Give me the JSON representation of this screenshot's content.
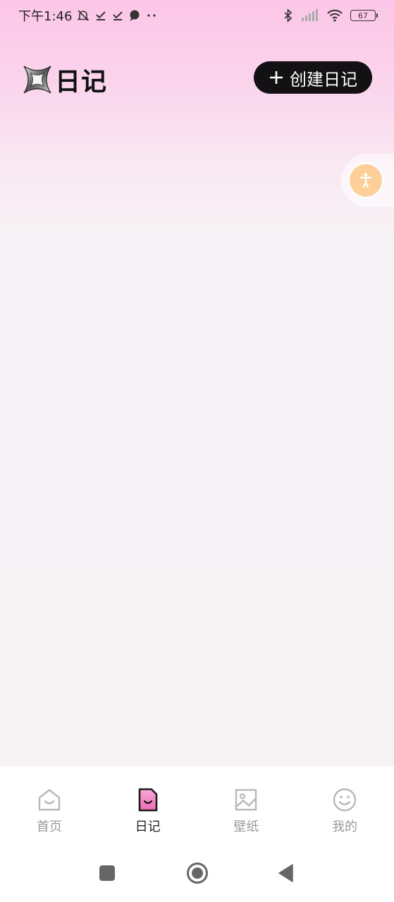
{
  "status_bar": {
    "time": "下午1:46",
    "battery": "67"
  },
  "header": {
    "title": "日记",
    "create_button_label": "创建日记"
  },
  "tabs": [
    {
      "label": "首页",
      "active": false
    },
    {
      "label": "日记",
      "active": true
    },
    {
      "label": "壁纸",
      "active": false
    },
    {
      "label": "我的",
      "active": false
    }
  ],
  "colors": {
    "accent_pink": "#f37fc0",
    "button_dark": "#141114",
    "float_orange": "#fdd09a"
  }
}
